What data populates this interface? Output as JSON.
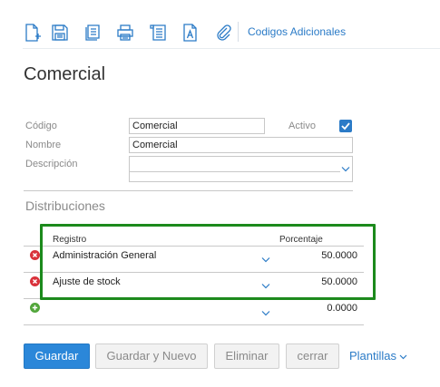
{
  "toolbar": {
    "icons": [
      "new-document-icon",
      "save-icon",
      "list-document-icon",
      "print-icon",
      "report-icon",
      "text-document-icon",
      "attachment-icon"
    ],
    "link_label": "Codigos Adicionales",
    "accent_color": "#2b7bc7"
  },
  "page": {
    "title": "Comercial"
  },
  "form": {
    "codigo_label": "Código",
    "codigo_value": "Comercial",
    "activo_label": "Activo",
    "activo_checked": true,
    "nombre_label": "Nombre",
    "nombre_value": "Comercial",
    "descripcion_label": "Descripción",
    "descripcion_value": ""
  },
  "distribuciones": {
    "title": "Distribuciones",
    "columns": {
      "registro": "Registro",
      "porcentaje": "Porcentaje"
    },
    "rows": [
      {
        "registro": "Administración General",
        "porcentaje": "50.0000"
      },
      {
        "registro": "Ajuste de stock",
        "porcentaje": "50.0000"
      }
    ],
    "new_row": {
      "registro": "",
      "porcentaje": "0.0000"
    },
    "highlight_color": "#1c8a1c"
  },
  "buttons": {
    "guardar": "Guardar",
    "guardar_nuevo": "Guardar y Nuevo",
    "eliminar": "Eliminar",
    "cerrar": "cerrar",
    "plantillas": "Plantillas"
  }
}
